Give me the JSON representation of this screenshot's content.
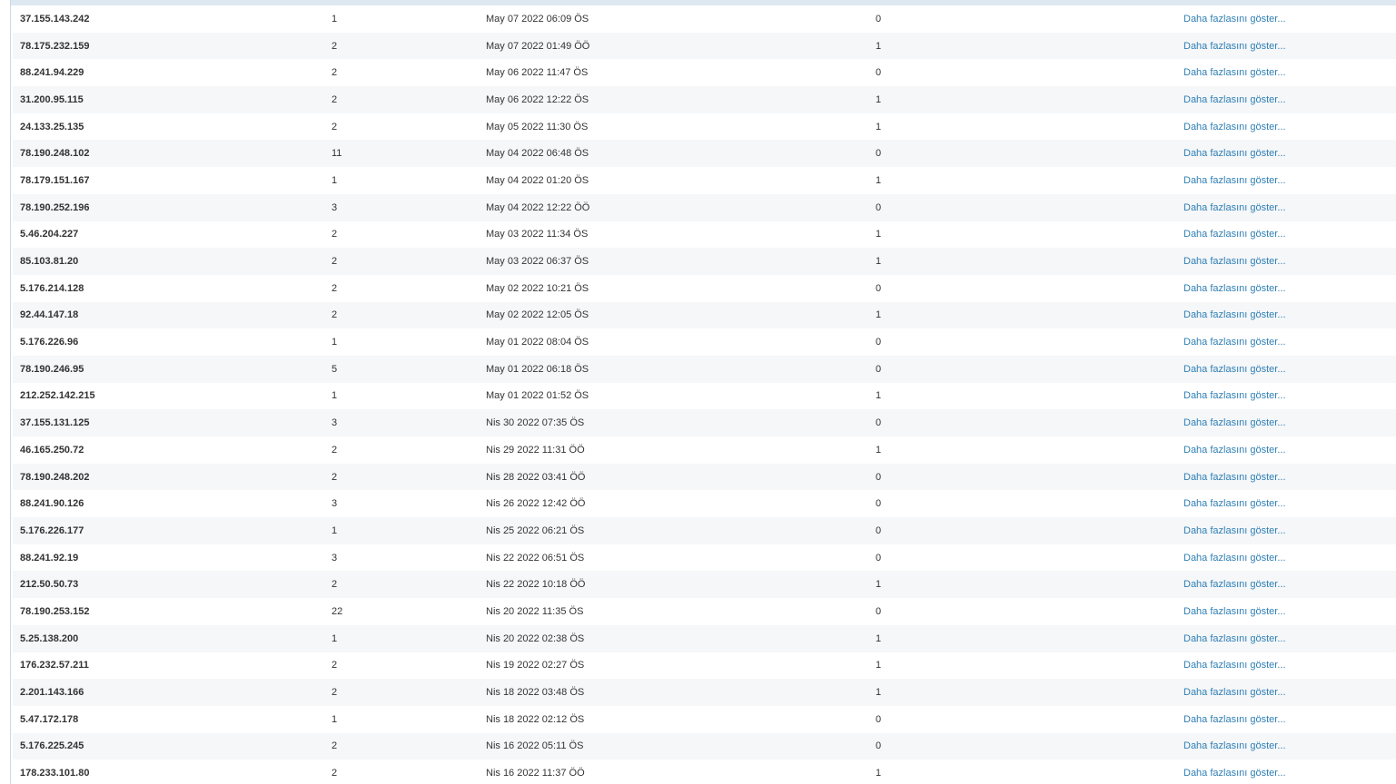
{
  "table": {
    "rows": [
      {
        "ip": "37.155.143.242",
        "count": "1",
        "date": "May 07 2022 06:09 ÖS",
        "flag": "0",
        "action": "Daha fazlasını göster..."
      },
      {
        "ip": "78.175.232.159",
        "count": "2",
        "date": "May 07 2022 01:49 ÖÖ",
        "flag": "1",
        "action": "Daha fazlasını göster..."
      },
      {
        "ip": "88.241.94.229",
        "count": "2",
        "date": "May 06 2022 11:47 ÖS",
        "flag": "0",
        "action": "Daha fazlasını göster..."
      },
      {
        "ip": "31.200.95.115",
        "count": "2",
        "date": "May 06 2022 12:22 ÖS",
        "flag": "1",
        "action": "Daha fazlasını göster..."
      },
      {
        "ip": "24.133.25.135",
        "count": "2",
        "date": "May 05 2022 11:30 ÖS",
        "flag": "1",
        "action": "Daha fazlasını göster..."
      },
      {
        "ip": "78.190.248.102",
        "count": "11",
        "date": "May 04 2022 06:48 ÖS",
        "flag": "0",
        "action": "Daha fazlasını göster..."
      },
      {
        "ip": "78.179.151.167",
        "count": "1",
        "date": "May 04 2022 01:20 ÖS",
        "flag": "1",
        "action": "Daha fazlasını göster..."
      },
      {
        "ip": "78.190.252.196",
        "count": "3",
        "date": "May 04 2022 12:22 ÖÖ",
        "flag": "0",
        "action": "Daha fazlasını göster..."
      },
      {
        "ip": "5.46.204.227",
        "count": "2",
        "date": "May 03 2022 11:34 ÖS",
        "flag": "1",
        "action": "Daha fazlasını göster..."
      },
      {
        "ip": "85.103.81.20",
        "count": "2",
        "date": "May 03 2022 06:37 ÖS",
        "flag": "1",
        "action": "Daha fazlasını göster..."
      },
      {
        "ip": "5.176.214.128",
        "count": "2",
        "date": "May 02 2022 10:21 ÖS",
        "flag": "0",
        "action": "Daha fazlasını göster..."
      },
      {
        "ip": "92.44.147.18",
        "count": "2",
        "date": "May 02 2022 12:05 ÖS",
        "flag": "1",
        "action": "Daha fazlasını göster..."
      },
      {
        "ip": "5.176.226.96",
        "count": "1",
        "date": "May 01 2022 08:04 ÖS",
        "flag": "0",
        "action": "Daha fazlasını göster..."
      },
      {
        "ip": "78.190.246.95",
        "count": "5",
        "date": "May 01 2022 06:18 ÖS",
        "flag": "0",
        "action": "Daha fazlasını göster..."
      },
      {
        "ip": "212.252.142.215",
        "count": "1",
        "date": "May 01 2022 01:52 ÖS",
        "flag": "1",
        "action": "Daha fazlasını göster..."
      },
      {
        "ip": "37.155.131.125",
        "count": "3",
        "date": "Nis 30 2022 07:35 ÖS",
        "flag": "0",
        "action": "Daha fazlasını göster..."
      },
      {
        "ip": "46.165.250.72",
        "count": "2",
        "date": "Nis 29 2022 11:31 ÖÖ",
        "flag": "1",
        "action": "Daha fazlasını göster..."
      },
      {
        "ip": "78.190.248.202",
        "count": "2",
        "date": "Nis 28 2022 03:41 ÖÖ",
        "flag": "0",
        "action": "Daha fazlasını göster..."
      },
      {
        "ip": "88.241.90.126",
        "count": "3",
        "date": "Nis 26 2022 12:42 ÖÖ",
        "flag": "0",
        "action": "Daha fazlasını göster..."
      },
      {
        "ip": "5.176.226.177",
        "count": "1",
        "date": "Nis 25 2022 06:21 ÖS",
        "flag": "0",
        "action": "Daha fazlasını göster..."
      },
      {
        "ip": "88.241.92.19",
        "count": "3",
        "date": "Nis 22 2022 06:51 ÖS",
        "flag": "0",
        "action": "Daha fazlasını göster..."
      },
      {
        "ip": "212.50.50.73",
        "count": "2",
        "date": "Nis 22 2022 10:18 ÖÖ",
        "flag": "1",
        "action": "Daha fazlasını göster..."
      },
      {
        "ip": "78.190.253.152",
        "count": "22",
        "date": "Nis 20 2022 11:35 ÖS",
        "flag": "0",
        "action": "Daha fazlasını göster..."
      },
      {
        "ip": "5.25.138.200",
        "count": "1",
        "date": "Nis 20 2022 02:38 ÖS",
        "flag": "1",
        "action": "Daha fazlasını göster..."
      },
      {
        "ip": "176.232.57.211",
        "count": "2",
        "date": "Nis 19 2022 02:27 ÖS",
        "flag": "1",
        "action": "Daha fazlasını göster..."
      },
      {
        "ip": "2.201.143.166",
        "count": "2",
        "date": "Nis 18 2022 03:48 ÖS",
        "flag": "1",
        "action": "Daha fazlasını göster..."
      },
      {
        "ip": "5.47.172.178",
        "count": "1",
        "date": "Nis 18 2022 02:12 ÖS",
        "flag": "0",
        "action": "Daha fazlasını göster..."
      },
      {
        "ip": "5.176.225.245",
        "count": "2",
        "date": "Nis 16 2022 05:11 ÖS",
        "flag": "0",
        "action": "Daha fazlasını göster..."
      },
      {
        "ip": "178.233.101.80",
        "count": "2",
        "date": "Nis 16 2022 11:37 ÖÖ",
        "flag": "1",
        "action": "Daha fazlasını göster..."
      }
    ]
  },
  "colors": {
    "link": "#2f7fb4",
    "row_alt": "#f5f7f9",
    "top_strip": "#dde8f1"
  }
}
